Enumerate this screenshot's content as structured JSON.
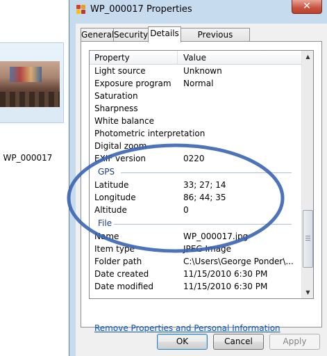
{
  "explorer": {
    "thumbnail_label": "WP_000017"
  },
  "dialog": {
    "title": "WP_000017 Properties",
    "close_label": "✕",
    "tabs": [
      "General",
      "Security",
      "Details",
      "Previous Versions"
    ],
    "active_tab": "Details",
    "list": {
      "columns": [
        "Property",
        "Value"
      ],
      "rows_camera": [
        {
          "prop": "Light source",
          "val": "Unknown"
        },
        {
          "prop": "Exposure program",
          "val": "Normal"
        },
        {
          "prop": "Saturation",
          "val": ""
        },
        {
          "prop": "Sharpness",
          "val": ""
        },
        {
          "prop": "White balance",
          "val": ""
        },
        {
          "prop": "Photometric interpretation",
          "val": ""
        },
        {
          "prop": "Digital zoom",
          "val": ""
        },
        {
          "prop": "EXIF version",
          "val": "0220"
        }
      ],
      "gps_title": "GPS",
      "rows_gps": [
        {
          "prop": "Latitude",
          "val": "33; 27; 14"
        },
        {
          "prop": "Longitude",
          "val": "86; 44; 35"
        },
        {
          "prop": "Altitude",
          "val": "0"
        }
      ],
      "file_title": "File",
      "rows_file": [
        {
          "prop": "Name",
          "val": "WP_000017.jpg"
        },
        {
          "prop": "Item type",
          "val": "JPEG Image"
        },
        {
          "prop": "Folder path",
          "val": "C:\\Users\\George Ponder\\..."
        },
        {
          "prop": "Date created",
          "val": "11/15/2010 6:30 PM"
        },
        {
          "prop": "Date modified",
          "val": "11/15/2010 6:30 PM"
        }
      ]
    },
    "remove_link": "Remove Properties and Personal Information",
    "buttons": {
      "ok": "OK",
      "cancel": "Cancel",
      "apply": "Apply"
    }
  },
  "colors": {
    "annotation_ellipse": "#3a64b4",
    "group_title": "#1e3c8c",
    "link": "#0b55c4"
  }
}
